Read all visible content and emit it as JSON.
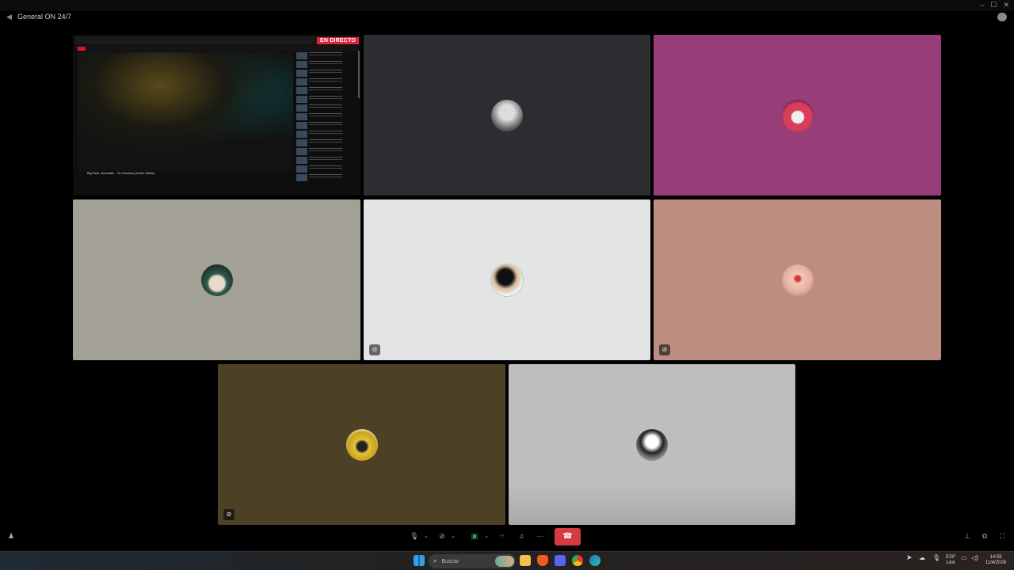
{
  "window": {
    "channel_name": "General ON 24/7",
    "controls": [
      "–",
      "☐",
      "✕"
    ]
  },
  "tiles": {
    "screenshare": {
      "live_label": "EN DIRECTO",
      "video_title": "Big Sam, cinematic - Te Creamos (Vídeo oficial)"
    },
    "participants": [
      {
        "bg": "#2c2d31",
        "avatar_colors": [
          "#ddd",
          "#555"
        ],
        "muted": false
      },
      {
        "bg": "#983d78",
        "avatar_colors": [
          "#d83d5a",
          "#eee"
        ],
        "muted": false
      },
      {
        "bg": "#a3a196",
        "avatar_colors": [
          "#2f5a4a",
          "#e9d9c9"
        ],
        "muted": false
      },
      {
        "bg": "#e3e4e6",
        "avatar_colors": [
          "#111",
          "#d8b89a"
        ],
        "muted": true
      },
      {
        "bg": "#bc8d80",
        "avatar_colors": [
          "#e8b0a0",
          "#d33"
        ],
        "muted": true
      },
      {
        "bg": "#4c4125",
        "avatar_colors": [
          "#e3c23a",
          "#222"
        ],
        "muted": true
      },
      {
        "bg": "#bebebe",
        "avatar_colors": [
          "#fff",
          "#222"
        ],
        "muted": false
      }
    ]
  },
  "toolbar": {
    "hangup_icon": "phone-hangup-icon"
  },
  "taskbar": {
    "search_placeholder": "Buscar",
    "lang_top": "ESP",
    "lang_bottom": "LAA",
    "time": "14:59",
    "date": "11/4/2026"
  }
}
